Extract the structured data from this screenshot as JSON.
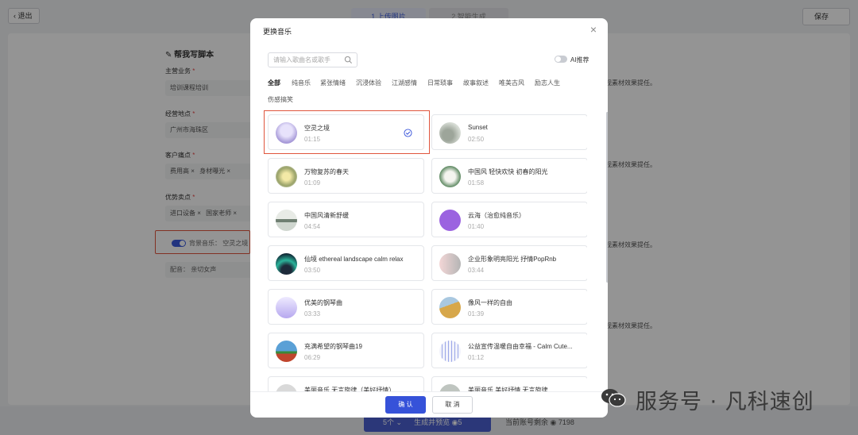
{
  "background": {
    "back_label": "退出",
    "steps": [
      "1 上传图片",
      "2 智能生成"
    ],
    "save_label": "保存",
    "form_title": "帮我写脚本",
    "fields": [
      {
        "label": "主营业务",
        "value": "培训课程培训"
      },
      {
        "label": "经营地点",
        "value": "广州市海珠区"
      },
      {
        "label": "客户痛点",
        "tags": [
          "费用高",
          "身材曝光"
        ]
      },
      {
        "label": "优势卖点",
        "tags": [
          "进口设备",
          "国家老师"
        ]
      }
    ],
    "bg_music_label": "背景音乐：",
    "bg_music_value": "空灵之境",
    "voice_label": "配音：",
    "voice_value": "亲切女声",
    "right_note": "视素材效果提任。",
    "gen_count": "5个",
    "gen_label": "生成并预览",
    "gen_cost": "5",
    "credits_label": "当前账号剩余",
    "credits_value": "7198"
  },
  "modal": {
    "title": "更换音乐",
    "search_placeholder": "请输入歌曲名或歌手",
    "ai_label": "AI推荐",
    "categories": [
      "全部",
      "纯音乐",
      "紧张情绪",
      "沉浸体验",
      "江湖感情",
      "日常琐事",
      "故事叙述",
      "唯美古风",
      "励志人生",
      "伤感搞笑"
    ],
    "active_category": "全部",
    "songs": [
      {
        "name": "空灵之境",
        "duration": "01:15",
        "selected": true
      },
      {
        "name": "Sunset",
        "duration": "02:50"
      },
      {
        "name": "万物复苏的春天",
        "duration": "01:09"
      },
      {
        "name": "中国风 轻快欢快 初春的阳光",
        "duration": "01:58"
      },
      {
        "name": "中国风清新舒缓",
        "duration": "04:54"
      },
      {
        "name": "云海（治愈纯音乐）",
        "duration": "01:40"
      },
      {
        "name": "仙境 ethereal landscape calm relax",
        "duration": "03:50"
      },
      {
        "name": "企业形象明亮阳光 抒情PopRnb",
        "duration": "03:44"
      },
      {
        "name": "优美的钢琴曲",
        "duration": "03:33"
      },
      {
        "name": "像风一样的自由",
        "duration": "01:39"
      },
      {
        "name": "充满希望的钢琴曲19",
        "duration": "06:29"
      },
      {
        "name": "公益宣传温暖自由幸福 - Calm Cute...",
        "duration": "01:12"
      },
      {
        "name": "美丽音乐 无言旋律（美好抒情）",
        "duration": ""
      },
      {
        "name": "美丽音乐 美好抒情 无言旋律",
        "duration": ""
      }
    ],
    "confirm_label": "确 认",
    "cancel_label": "取 消"
  },
  "watermark": "服务号 · 凡科速创",
  "colors": {
    "accent": "#3652d9",
    "highlight_frame": "#e0553d"
  }
}
